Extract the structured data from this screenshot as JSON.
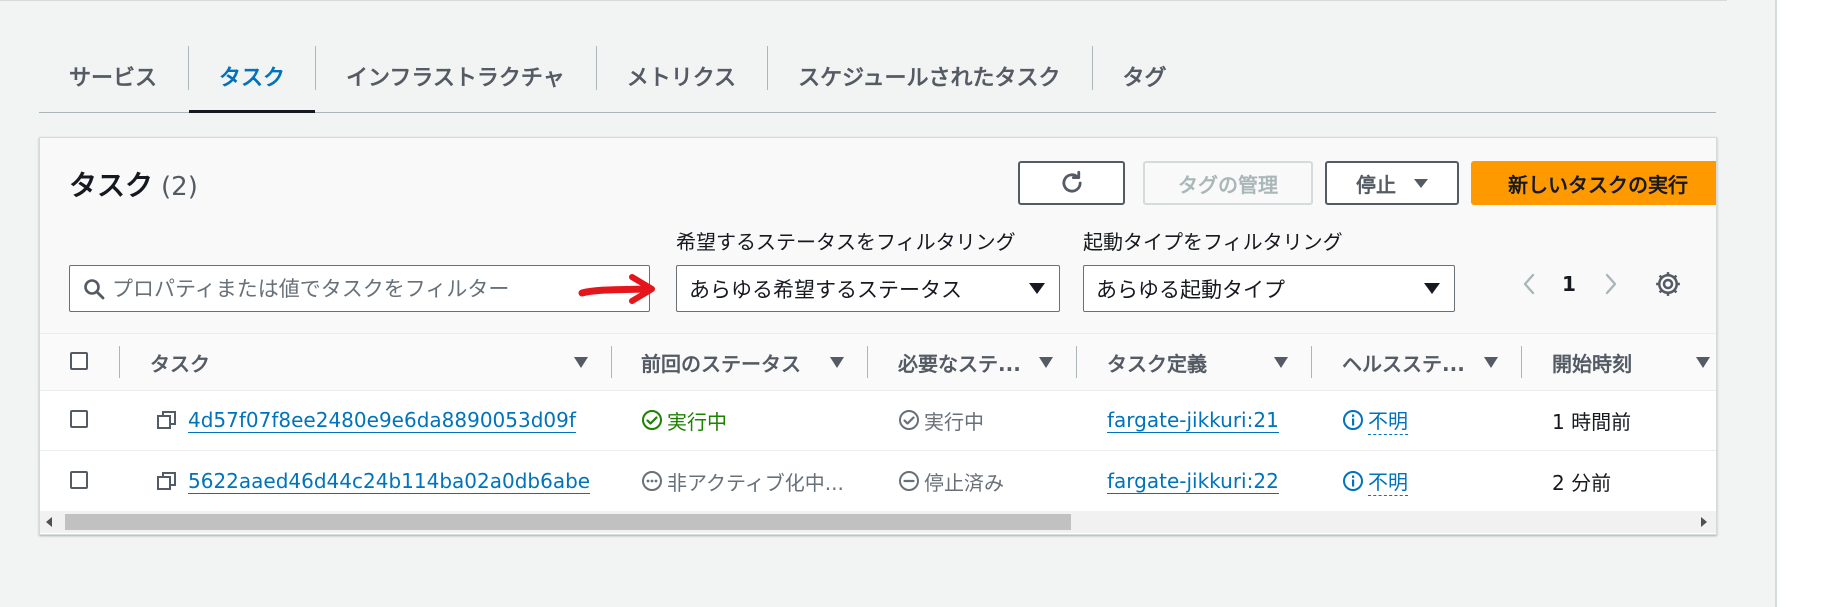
{
  "tabs": [
    {
      "label": "サービス"
    },
    {
      "label": "タスク"
    },
    {
      "label": "インフラストラクチャ"
    },
    {
      "label": "メトリクス"
    },
    {
      "label": "スケジュールされたタスク"
    },
    {
      "label": "タグ"
    }
  ],
  "active_tab": "タスク",
  "panel": {
    "title": "タスク",
    "count": "(2)",
    "buttons": {
      "manage_tags": "タグの管理",
      "stop": "停止",
      "run_task": "新しいタスクの実行"
    },
    "search": {
      "placeholder": "プロパティまたは値でタスクをフィルター"
    },
    "filters": {
      "desired_status_label": "希望するステータスをフィルタリング",
      "desired_status_value": "あらゆる希望するステータス",
      "launch_type_label": "起動タイプをフィルタリング",
      "launch_type_value": "あらゆる起動タイプ"
    },
    "pagination": {
      "current_page": "1"
    }
  },
  "table": {
    "columns": [
      "タスク",
      "前回のステータス",
      "必要なステ...",
      "タスク定義",
      "ヘルスステ...",
      "開始時刻"
    ],
    "rows": [
      {
        "task": "4d57f07f8ee2480e9e6da8890053d09f",
        "last_status": "実行中",
        "desired_status": "実行中",
        "task_definition": "fargate-jikkuri:21",
        "health": "不明",
        "started": "1 時間前"
      },
      {
        "task": "5622aaed46d44c24b114ba02a0db6abe",
        "last_status": "非アクティブ化中...",
        "desired_status": "停止済み",
        "task_definition": "fargate-jikkuri:22",
        "health": "不明",
        "started": "2 分前"
      }
    ]
  },
  "colors": {
    "accent": "#0073bb",
    "primary_button": "#ff9900",
    "running": "#1d8102",
    "annotation_arrow": "#e4161b"
  }
}
